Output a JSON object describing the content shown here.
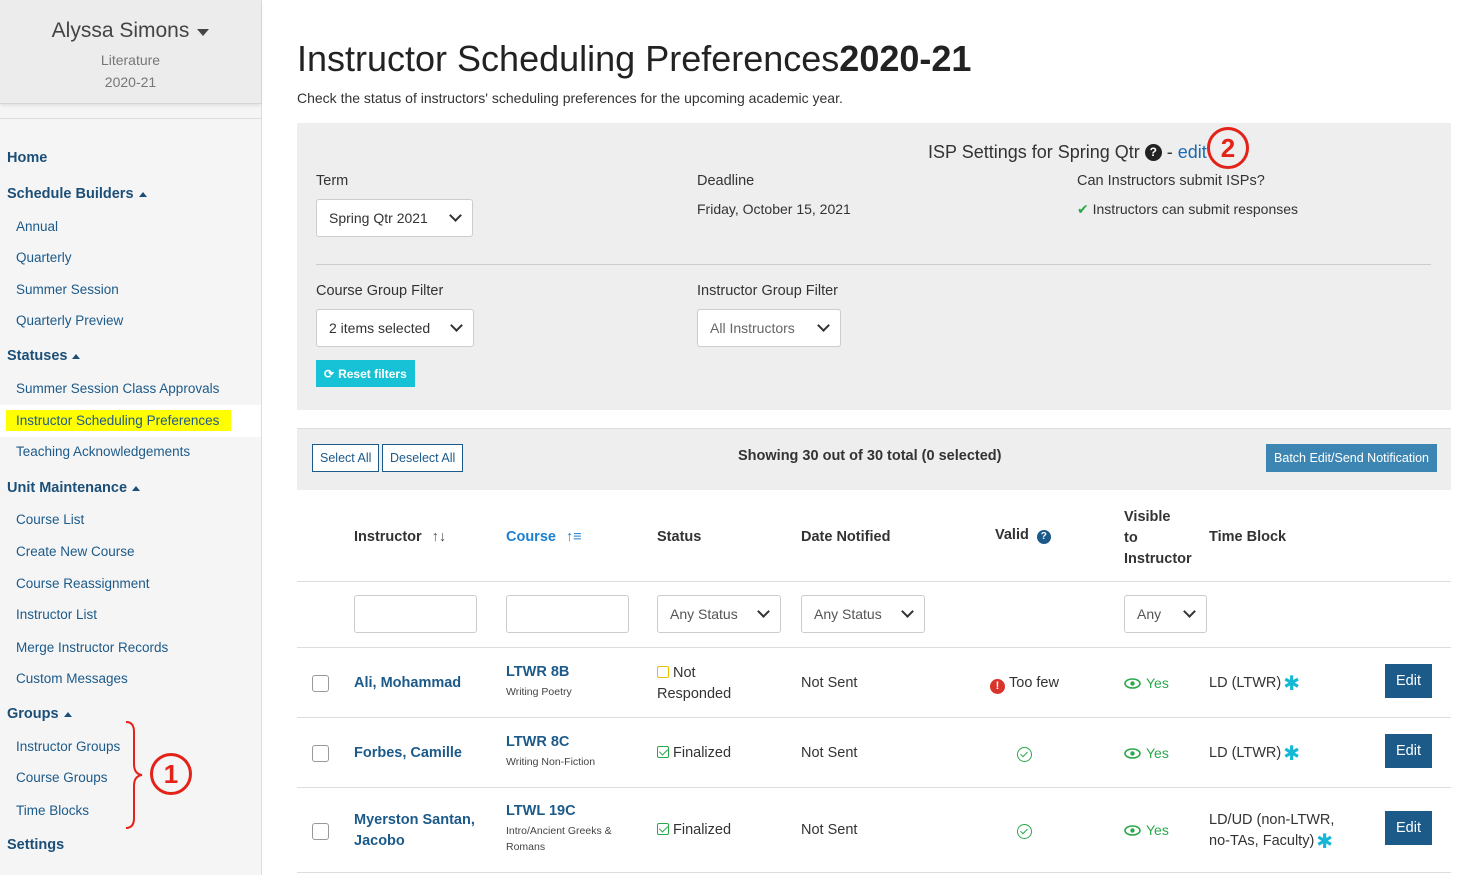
{
  "user": {
    "name": "Alyssa Simons",
    "department": "Literature",
    "year": "2020-21"
  },
  "sidebar": {
    "home": "Home",
    "schedule_builders": {
      "label": "Schedule Builders",
      "items": [
        "Annual",
        "Quarterly",
        "Summer Session",
        "Quarterly Preview"
      ]
    },
    "statuses": {
      "label": "Statuses",
      "items": [
        "Summer Session Class Approvals",
        "Instructor Scheduling Preferences",
        "Teaching Acknowledgements"
      ]
    },
    "unit_maintenance": {
      "label": "Unit Maintenance",
      "items": [
        "Course List",
        "Create New Course",
        "Course Reassignment",
        "Instructor List",
        "Merge Instructor Records",
        "Custom Messages"
      ]
    },
    "groups": {
      "label": "Groups",
      "items": [
        "Instructor Groups",
        "Course Groups",
        "Time Blocks"
      ]
    },
    "settings": "Settings"
  },
  "annotations": {
    "one": "1",
    "two": "2"
  },
  "page": {
    "title": "Instructor Scheduling Preferences",
    "title_year": "2020-21",
    "description": "Check the status of instructors' scheduling preferences for the upcoming academic year."
  },
  "settings_panel": {
    "isp_settings_label": "ISP Settings for Spring Qtr",
    "help_glyph": "?",
    "separator": "-",
    "edit_link": "edit",
    "term_label": "Term",
    "term_value": "Spring Qtr 2021",
    "deadline_label": "Deadline",
    "deadline_value": "Friday, October 15, 2021",
    "can_submit_label": "Can Instructors submit ISPs?",
    "can_submit_value": "Instructors can submit responses",
    "course_group_label": "Course Group Filter",
    "course_group_value": "2 items selected",
    "instructor_group_label": "Instructor Group Filter",
    "instructor_group_value": "All Instructors",
    "reset_button": "Reset filters"
  },
  "toolbar": {
    "select_all": "Select All",
    "deselect_all": "Deselect All",
    "showing": "Showing 30 out of 30 total (0 selected)",
    "batch_button": "Batch Edit/Send Notification"
  },
  "table": {
    "headers": {
      "instructor": "Instructor",
      "course": "Course",
      "status": "Status",
      "date_notified": "Date Notified",
      "valid": "Valid",
      "visible_1": "Visible",
      "visible_2": "to",
      "visible_3": "Instructor",
      "time_block": "Time Block"
    },
    "filters": {
      "status": "Any Status",
      "date_notified": "Any Status",
      "visible": "Any"
    },
    "rows": [
      {
        "instructor_1": "Ali, Mohammad",
        "instructor_2": "",
        "course_code": "LTWR 8B",
        "course_name_1": "Writing Poetry",
        "course_name_2": "",
        "status_1": "Not",
        "status_2": "Responded",
        "date_notified": "Not Sent",
        "valid": "Too few",
        "visible": "Yes",
        "time_block_1": "LD (LTWR)",
        "time_block_2": "",
        "edit": "Edit"
      },
      {
        "instructor_1": "Forbes, Camille",
        "instructor_2": "",
        "course_code": "LTWR 8C",
        "course_name_1": "Writing Non-Fiction",
        "course_name_2": "",
        "status_1": "Finalized",
        "status_2": "",
        "date_notified": "Not Sent",
        "valid": "",
        "visible": "Yes",
        "time_block_1": "LD (LTWR)",
        "time_block_2": "",
        "edit": "Edit"
      },
      {
        "instructor_1": "Myerston Santan,",
        "instructor_2": "Jacobo",
        "course_code": "LTWL 19C",
        "course_name_1": "Intro/Ancient Greeks &",
        "course_name_2": "Romans",
        "status_1": "Finalized",
        "status_2": "",
        "date_notified": "Not Sent",
        "valid": "",
        "visible": "Yes",
        "time_block_1": "LD/UD (non-LTWR,",
        "time_block_2": "no-TAs, Faculty)",
        "edit": "Edit"
      }
    ]
  },
  "icons": {
    "user_menu": "caret-down-icon",
    "section_toggle": "caret-up-icon",
    "help": "question-circle-icon",
    "valid_ok": "check-circle-icon",
    "valid_error": "exclamation-circle-icon",
    "visible": "eye-icon",
    "time_block_marker": "asterisk-icon",
    "reset": "refresh-icon",
    "sort": "sort-icon"
  },
  "colors": {
    "nav_blue": "#1c5a8a",
    "accent_cyan": "#17c1d6",
    "success_green": "#2aa84a",
    "error_red": "#d9342b",
    "highlight_yellow": "#ffff00",
    "annotation_red": "#e32219"
  }
}
